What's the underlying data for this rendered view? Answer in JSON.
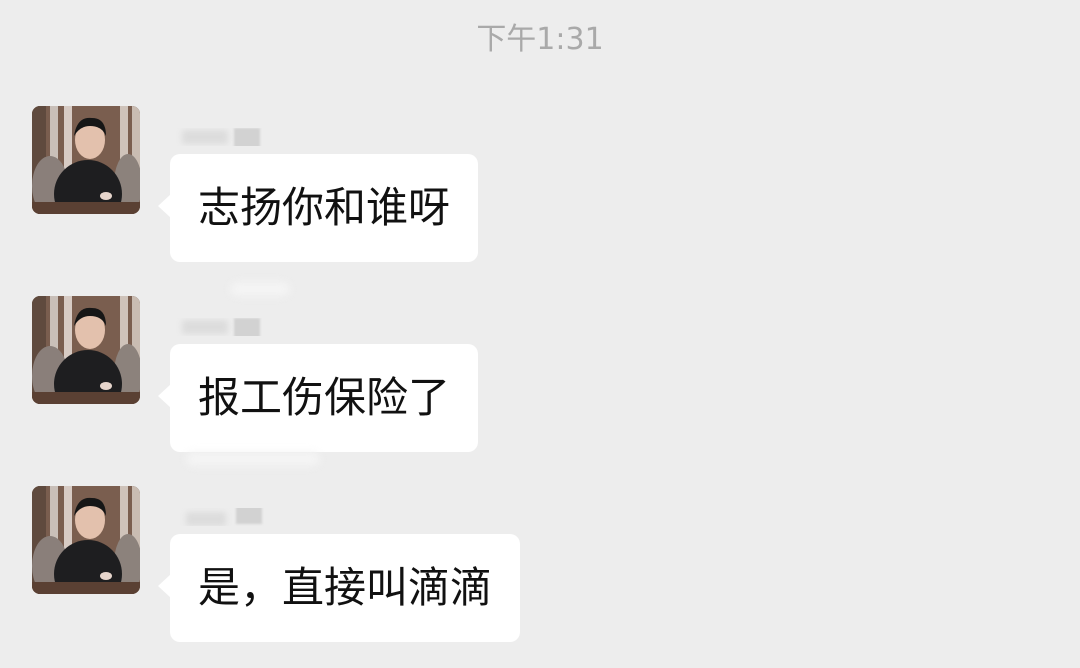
{
  "header": {
    "timestamp": "下午1:31"
  },
  "messages": [
    {
      "text": "志扬你和谁呀"
    },
    {
      "text": "报工伤保险了"
    },
    {
      "text": "是，直接叫滴滴"
    }
  ],
  "colors": {
    "background": "#ededed",
    "bubble": "#ffffff",
    "timestamp": "#a9a9a9",
    "text": "#111111"
  }
}
